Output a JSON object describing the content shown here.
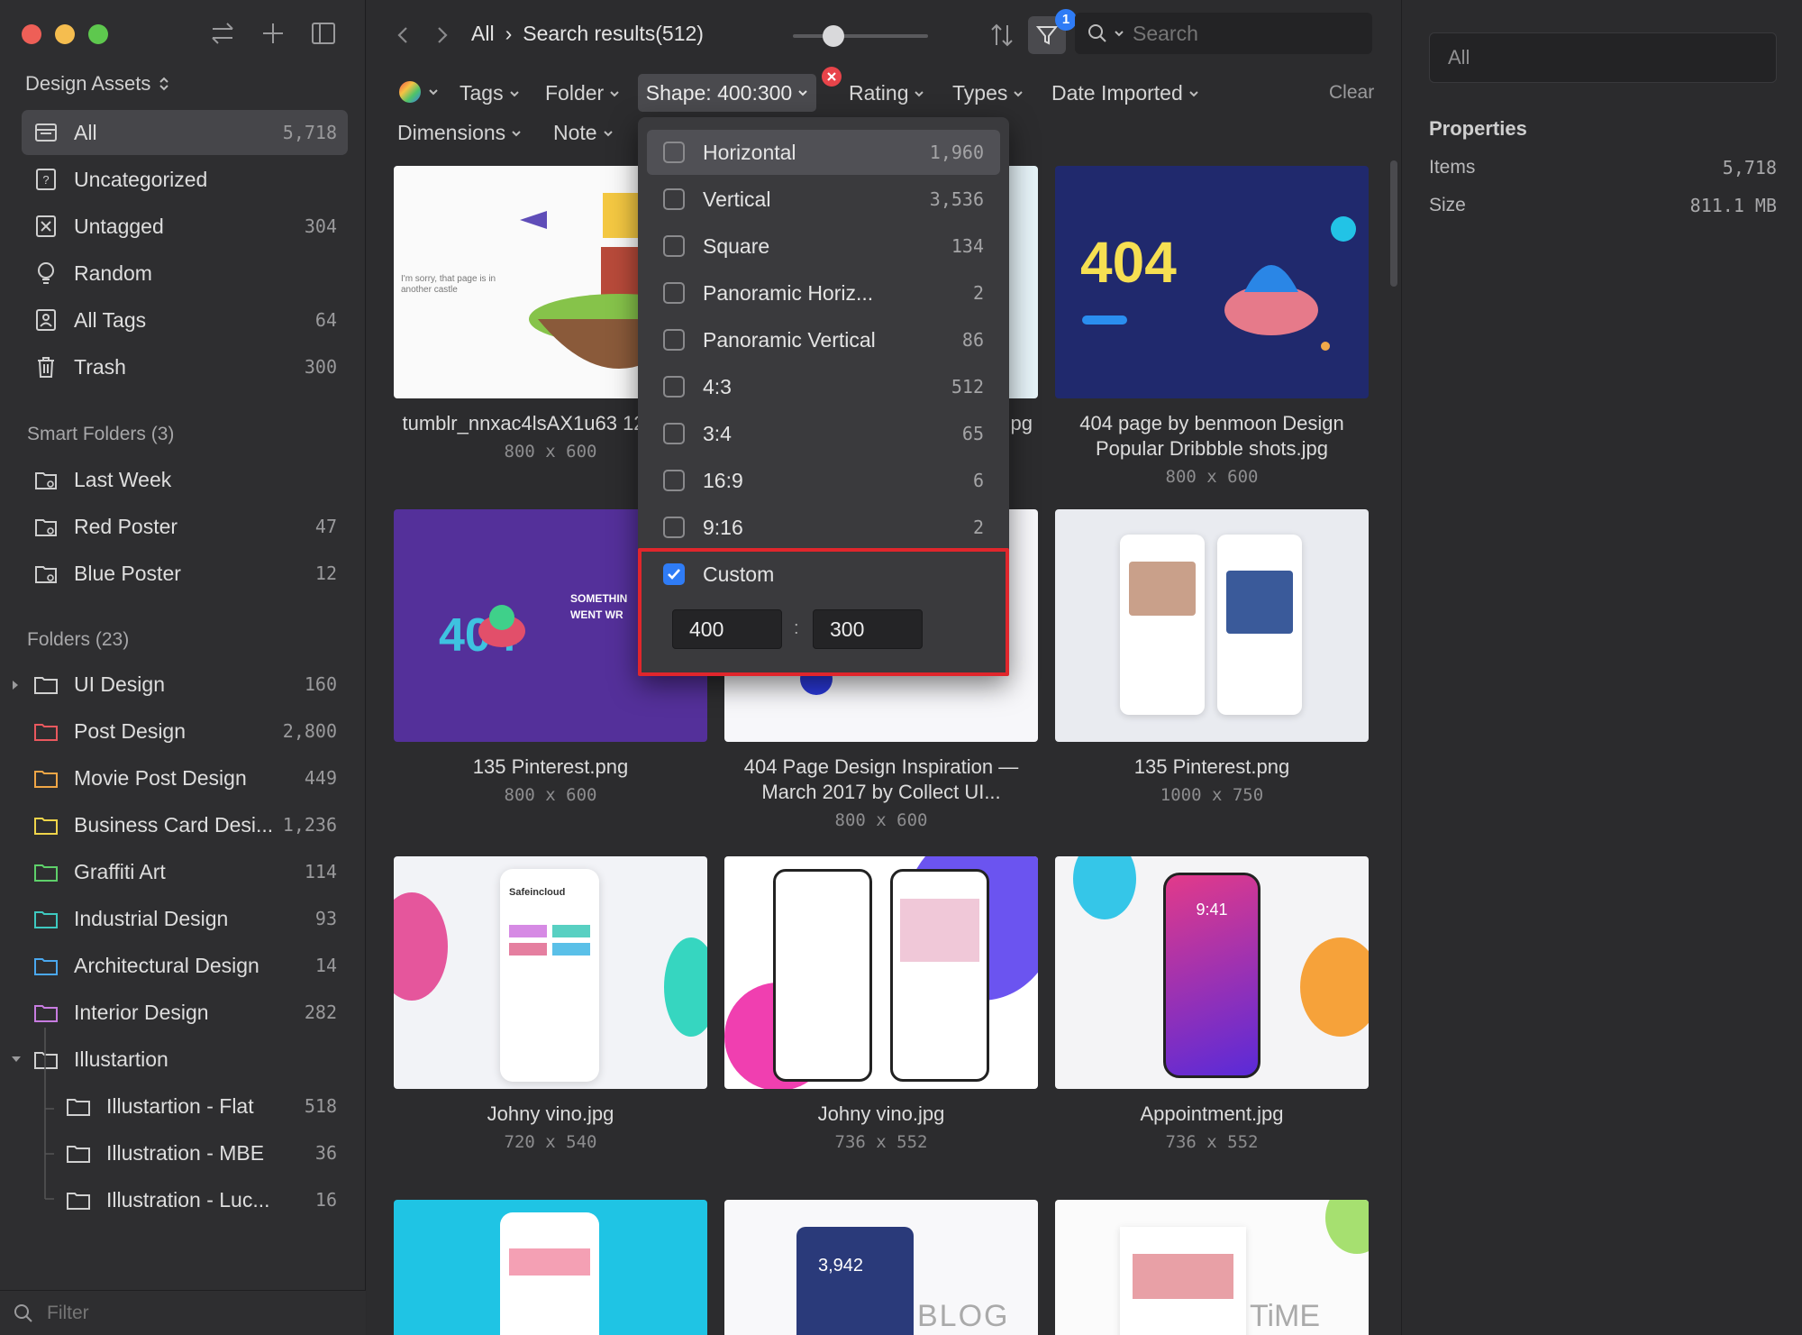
{
  "colors": {
    "accent": "#2f7cf6",
    "highlight_border": "#e0262c",
    "close_red": "#e8444a"
  },
  "sidebar": {
    "library_title": "Design Assets",
    "library_chevron": "⌃",
    "items": [
      {
        "label": "All",
        "count": "5,718",
        "icon": "all-icon"
      },
      {
        "label": "Uncategorized",
        "count": "",
        "icon": "uncategorized-icon"
      },
      {
        "label": "Untagged",
        "count": "304",
        "icon": "untagged-icon"
      },
      {
        "label": "Random",
        "count": "",
        "icon": "random-icon"
      },
      {
        "label": "All Tags",
        "count": "64",
        "icon": "tags-icon"
      },
      {
        "label": "Trash",
        "count": "300",
        "icon": "trash-icon"
      }
    ],
    "smart_folders_title": "Smart Folders (3)",
    "smart_folders": [
      {
        "label": "Last Week",
        "count": ""
      },
      {
        "label": "Red Poster",
        "count": "47"
      },
      {
        "label": "Blue Poster",
        "count": "12"
      }
    ],
    "folders_title": "Folders (23)",
    "folders": [
      {
        "label": "UI Design",
        "count": "160",
        "color": "#d0d0d0"
      },
      {
        "label": "Post Design",
        "count": "2,800",
        "color": "#e9585e"
      },
      {
        "label": "Movie Post Design",
        "count": "449",
        "color": "#f0a646"
      },
      {
        "label": "Business Card Desi...",
        "count": "1,236",
        "color": "#efd44a"
      },
      {
        "label": "Graffiti Art",
        "count": "114",
        "color": "#5ed06a"
      },
      {
        "label": "Industrial Design",
        "count": "93",
        "color": "#3ec9c0"
      },
      {
        "label": "Architectural Design",
        "count": "14",
        "color": "#4aa8ef"
      },
      {
        "label": "Interior Design",
        "count": "282",
        "color": "#c77ce0"
      },
      {
        "label": "Illustartion",
        "count": "",
        "color": "#d0d0d0"
      }
    ],
    "subfolders": [
      {
        "label": "Illustartion - Flat",
        "count": "518"
      },
      {
        "label": "Illustration - MBE",
        "count": "36"
      },
      {
        "label": "Illustration - Luc...",
        "count": "16"
      }
    ],
    "filter_placeholder": "Filter"
  },
  "topbar": {
    "crumb_root": "All",
    "crumb_sep": "›",
    "crumb_current": "Search results(512)",
    "filter_badge": "1",
    "search_placeholder": "Search",
    "zoom_level": 0.3
  },
  "filters": {
    "tags": "Tags",
    "folder": "Folder",
    "shape": "Shape: 400:300",
    "rating": "Rating",
    "types": "Types",
    "date": "Date Imported",
    "clear": "Clear",
    "dimensions": "Dimensions",
    "note": "Note"
  },
  "shape_menu": {
    "options": [
      {
        "label": "Horizontal",
        "count": "1,960",
        "checked": false
      },
      {
        "label": "Vertical",
        "count": "3,536",
        "checked": false
      },
      {
        "label": "Square",
        "count": "134",
        "checked": false
      },
      {
        "label": "Panoramic Horiz...",
        "count": "2",
        "checked": false
      },
      {
        "label": "Panoramic Vertical",
        "count": "86",
        "checked": false
      },
      {
        "label": "4:3",
        "count": "512",
        "checked": false
      },
      {
        "label": "3:4",
        "count": "65",
        "checked": false
      },
      {
        "label": "16:9",
        "count": "6",
        "checked": false
      },
      {
        "label": "9:16",
        "count": "2",
        "checked": false
      },
      {
        "label": "Custom",
        "count": "",
        "checked": true
      }
    ],
    "custom_width": "400",
    "custom_sep": ":",
    "custom_height": "300"
  },
  "grid": [
    {
      "name": "tumblr_nnxac4lsAX1u63 1280.jpg",
      "dims": "800 x 600"
    },
    {
      "name": "pg",
      "dims": ""
    },
    {
      "name": "404 page by benmoon Design Popular Dribbble shots.jpg",
      "dims": "800 x 600"
    },
    {
      "name": "135 Pinterest.png",
      "dims": "800 x 600"
    },
    {
      "name": "404 Page Design Inspiration — March 2017 by Collect UI...",
      "dims": "800 x 600"
    },
    {
      "name": "135 Pinterest.png",
      "dims": "1000 x 750"
    },
    {
      "name": "Johny vino.jpg",
      "dims": "720 x 540"
    },
    {
      "name": "Johny vino.jpg",
      "dims": "736 x 552"
    },
    {
      "name": "Appointment.jpg",
      "dims": "736 x 552"
    }
  ],
  "thumb_text": {
    "sorry": "I'm sorry, that page is in another castle",
    "big404": "404",
    "something": "SOMETHIN WENT WR",
    "safe": "Safeincloud",
    "time": "9:41",
    "num": "3,942",
    "blog": "BLOG",
    "timeword": "TiME"
  },
  "right": {
    "input_value": "All",
    "properties_title": "Properties",
    "items_label": "Items",
    "items_value": "5,718",
    "size_label": "Size",
    "size_value": "811.1 MB"
  }
}
